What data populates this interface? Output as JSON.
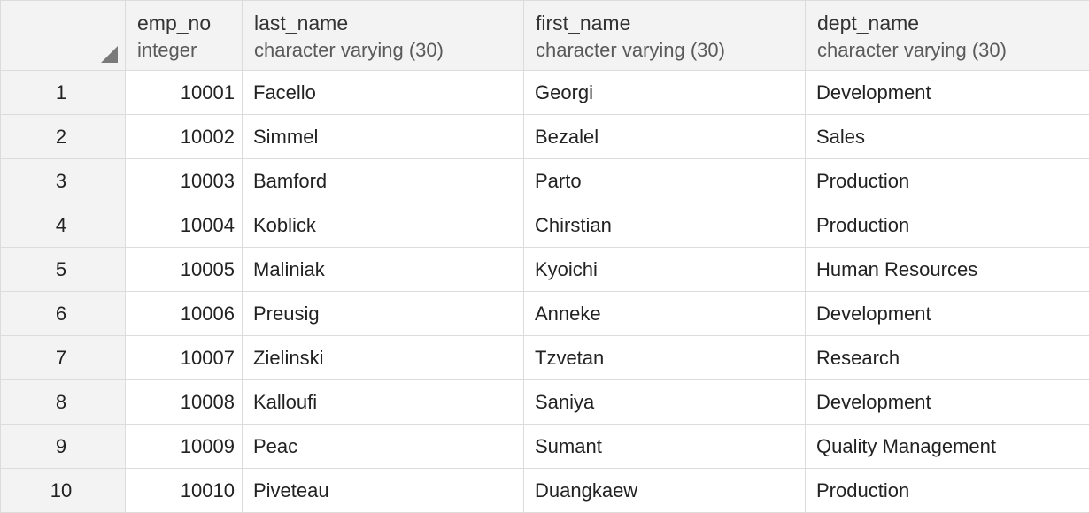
{
  "columns": [
    {
      "name": "emp_no",
      "type": "integer"
    },
    {
      "name": "last_name",
      "type": "character varying (30)"
    },
    {
      "name": "first_name",
      "type": "character varying (30)"
    },
    {
      "name": "dept_name",
      "type": "character varying (30)"
    }
  ],
  "rows": [
    {
      "row": "1",
      "emp_no": "10001",
      "last_name": "Facello",
      "first_name": "Georgi",
      "dept_name": "Development"
    },
    {
      "row": "2",
      "emp_no": "10002",
      "last_name": "Simmel",
      "first_name": "Bezalel",
      "dept_name": "Sales"
    },
    {
      "row": "3",
      "emp_no": "10003",
      "last_name": "Bamford",
      "first_name": "Parto",
      "dept_name": "Production"
    },
    {
      "row": "4",
      "emp_no": "10004",
      "last_name": "Koblick",
      "first_name": "Chirstian",
      "dept_name": "Production"
    },
    {
      "row": "5",
      "emp_no": "10005",
      "last_name": "Maliniak",
      "first_name": "Kyoichi",
      "dept_name": "Human Resources"
    },
    {
      "row": "6",
      "emp_no": "10006",
      "last_name": "Preusig",
      "first_name": "Anneke",
      "dept_name": "Development"
    },
    {
      "row": "7",
      "emp_no": "10007",
      "last_name": "Zielinski",
      "first_name": "Tzvetan",
      "dept_name": "Research"
    },
    {
      "row": "8",
      "emp_no": "10008",
      "last_name": "Kalloufi",
      "first_name": "Saniya",
      "dept_name": "Development"
    },
    {
      "row": "9",
      "emp_no": "10009",
      "last_name": "Peac",
      "first_name": "Sumant",
      "dept_name": "Quality Management"
    },
    {
      "row": "10",
      "emp_no": "10010",
      "last_name": "Piveteau",
      "first_name": "Duangkaew",
      "dept_name": "Production"
    }
  ]
}
